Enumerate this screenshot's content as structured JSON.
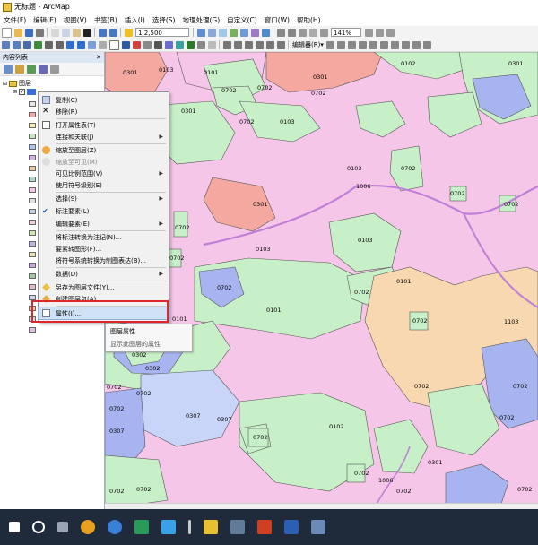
{
  "window": {
    "title": "无标题 - ArcMap"
  },
  "menubar": [
    "文件(F)",
    "编辑(E)",
    "视图(V)",
    "书签(B)",
    "插入(I)",
    "选择(S)",
    "地理处理(G)",
    "自定义(C)",
    "窗口(W)",
    "帮助(H)"
  ],
  "toolbar": {
    "scale": "1:2,500",
    "zoom": "141%",
    "editor_label": "编辑器(R)▾"
  },
  "toc": {
    "title": "内容列表",
    "close": "✕",
    "layers_label": "图层"
  },
  "context_menu": {
    "items": [
      {
        "label": "复制(C)"
      },
      {
        "label": "移除(R)"
      },
      {
        "label": "打开属性表(T)"
      },
      {
        "label": "连接和关联(J)"
      },
      {
        "label": "缩放至图层(Z)"
      },
      {
        "label": "缩放至可见(M)"
      },
      {
        "label": "可见比例范围(V)"
      },
      {
        "label": "使用符号级别(E)"
      },
      {
        "label": "选择(S)"
      },
      {
        "label": "标注要素(L)"
      },
      {
        "label": "编辑要素(E)"
      },
      {
        "label": "将标注转换为注记(N)..."
      },
      {
        "label": "要素转图形(F)..."
      },
      {
        "label": "将符号系统转换为制图表达(B)..."
      },
      {
        "label": "数据(D)"
      },
      {
        "label": "另存为图层文件(Y)..."
      },
      {
        "label": "创建图层包(A)..."
      },
      {
        "label": "属性(I)..."
      }
    ]
  },
  "tooltip": {
    "title": "图层属性",
    "description": "显示此图层的属性"
  },
  "map": {
    "labels": [
      "0301",
      "0103",
      "0101",
      "0702",
      "0702",
      "0702",
      "0301",
      "0102",
      "0301",
      "0301",
      "0702",
      "0103",
      "0103",
      "0702",
      "0301",
      "1006",
      "0702",
      "0103",
      "0103",
      "0702",
      "0702",
      "0702",
      "0101",
      "0101",
      "0702",
      "0702",
      "0702",
      "0101",
      "0302",
      "1103",
      "0302",
      "0702",
      "0702",
      "0702",
      "0307",
      "0307",
      "0702",
      "0307",
      "0702",
      "0702",
      "0702",
      "0102",
      "1006",
      "0702",
      "0702",
      "0702",
      "0301",
      "0702",
      "0702"
    ]
  }
}
